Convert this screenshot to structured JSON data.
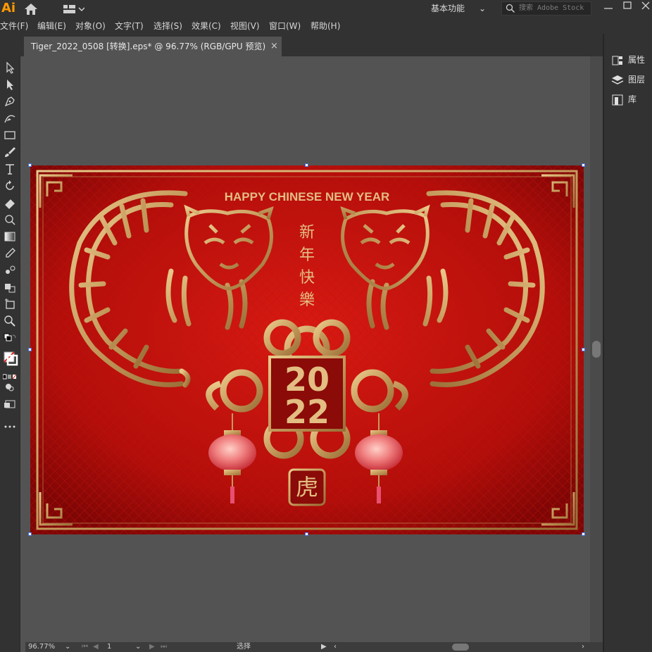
{
  "app": {
    "logo": "Ai",
    "workspace_label": "基本功能",
    "search_placeholder": "搜索 Adobe Stock"
  },
  "menu": [
    "文件(F)",
    "编辑(E)",
    "对象(O)",
    "文字(T)",
    "选择(S)",
    "效果(C)",
    "视图(V)",
    "窗口(W)",
    "帮助(H)"
  ],
  "document": {
    "tab_label": "Tiger_2022_0508 [转换].eps* @ 96.77% (RGB/GPU 预览)",
    "close_glyph": "×"
  },
  "right_panel": {
    "items": [
      "属性",
      "图层",
      "库"
    ]
  },
  "artwork": {
    "headline": "HAPPY CHINESE NEW YEAR",
    "vertical_text": [
      "新",
      "年",
      "快",
      "樂"
    ],
    "year_top": "20",
    "year_bottom": "22",
    "seal": "虎"
  },
  "status": {
    "zoom": "96.77%",
    "artboard_number": "1",
    "tool_mode": "选择"
  },
  "colors": {
    "accent_red": "#c8140f",
    "gold": "#c9a064",
    "ui_dark": "#323232",
    "canvas_gray": "#535353"
  }
}
